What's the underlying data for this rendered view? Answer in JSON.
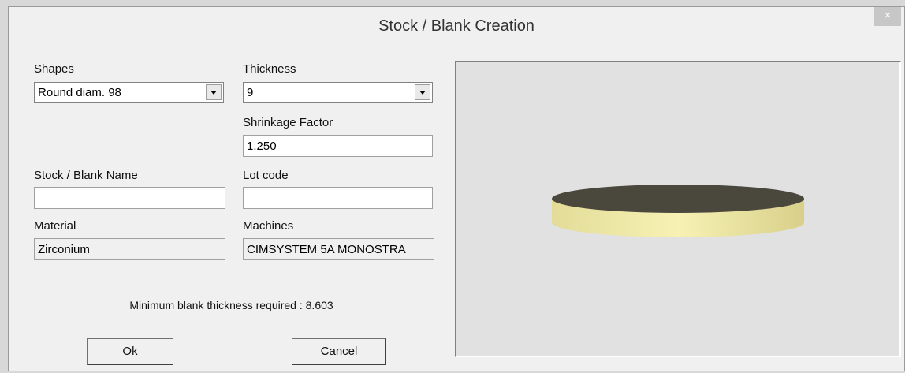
{
  "window": {
    "title": "Stock / Blank Creation",
    "close_glyph": "×"
  },
  "form": {
    "shapes": {
      "label": "Shapes",
      "value": "Round diam. 98"
    },
    "thickness": {
      "label": "Thickness",
      "value": "9"
    },
    "shrinkage": {
      "label": "Shrinkage Factor",
      "value": "1.250"
    },
    "blank_name": {
      "label": "Stock / Blank Name",
      "value": ""
    },
    "lot_code": {
      "label": "Lot code",
      "value": ""
    },
    "material": {
      "label": "Material",
      "value": "Zirconium"
    },
    "machines": {
      "label": "Machines",
      "value": "CIMSYSTEM 5A MONOSTRA"
    },
    "min_thickness": "Minimum blank thickness required : 8.603"
  },
  "buttons": {
    "ok": "Ok",
    "cancel": "Cancel"
  },
  "preview": {
    "disc_top_color": "#4a473d",
    "disc_side_color": "#f2eca8",
    "background_color": "#e1e1e1"
  }
}
